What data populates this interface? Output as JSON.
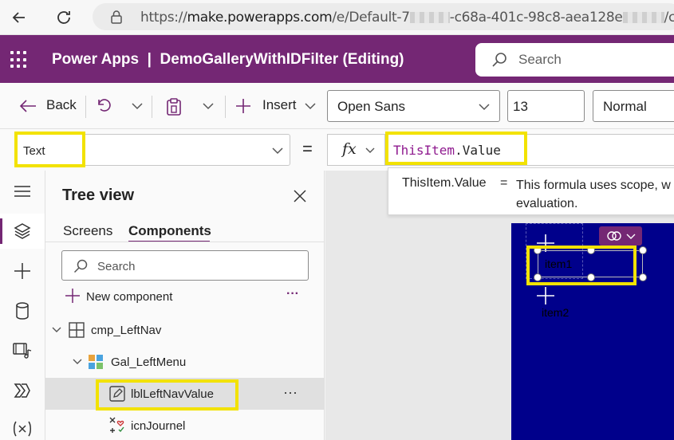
{
  "browser": {
    "url_prefix": "https://",
    "url_domain": "make.powerapps.com",
    "url_path_a": "/e/Default-7",
    "url_path_b": "-c68a-401c-98c8-aea128e",
    "url_path_c": "/can"
  },
  "header": {
    "app_name": "Power Apps",
    "separator": "|",
    "doc_title": "DemoGalleryWithIDFilter (Editing)",
    "search_placeholder": "Search"
  },
  "toolbar": {
    "back_label": "Back",
    "insert_label": "Insert",
    "font_value": "Open Sans",
    "font_size_value": "13",
    "font_weight_value": "Normal"
  },
  "formula": {
    "property_value": "Text",
    "equals": "=",
    "fx_label": "fx",
    "expr_object": "ThisItem",
    "expr_dot": ".",
    "expr_field": "Value"
  },
  "tooltip": {
    "name": "ThisItem.Value",
    "eq": "=",
    "description": "This formula uses scope, w evaluation."
  },
  "tree": {
    "title": "Tree view",
    "tabs": [
      {
        "label": "Screens"
      },
      {
        "label": "Components"
      }
    ],
    "search_placeholder": "Search",
    "new_component_label": "New component",
    "rows": [
      {
        "label": "cmp_LeftNav"
      },
      {
        "label": "Gal_LeftMenu"
      },
      {
        "label": "lblLeftNavValue"
      },
      {
        "label": "icnJournel"
      }
    ]
  },
  "canvas": {
    "item1": "item1",
    "item2": "item2"
  },
  "colors": {
    "brand": "#742774",
    "highlight": "#f2e200",
    "screen_bg": "#00008b",
    "formula_keyword": "#8f1a8f"
  }
}
